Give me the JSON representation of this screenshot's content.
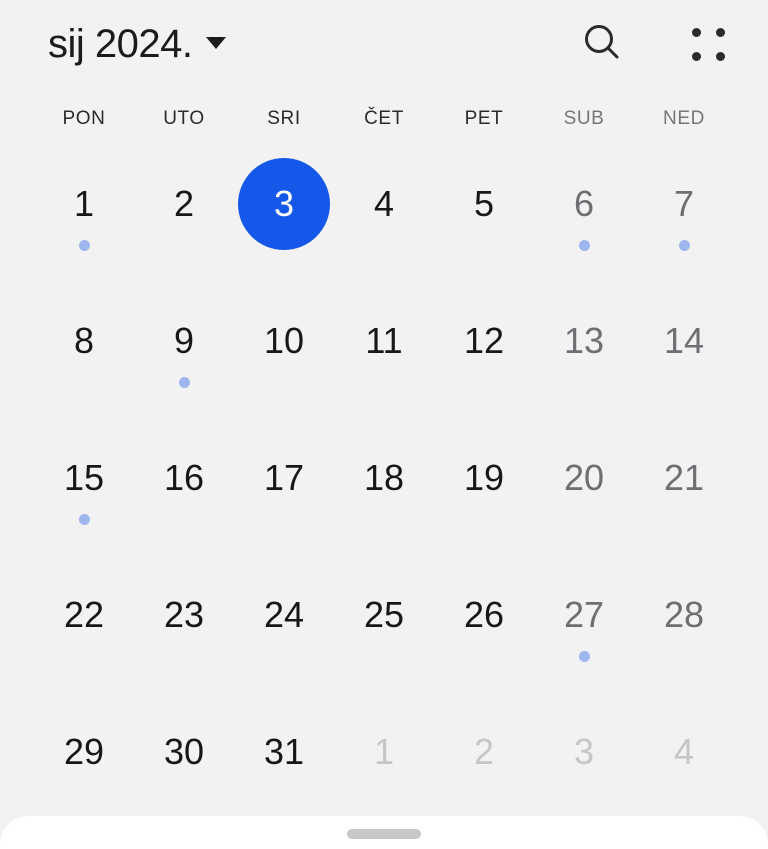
{
  "header": {
    "month_title": "sij 2024.",
    "caret_icon": "chevron-down-icon",
    "search_icon": "search-icon",
    "grid_icon": "four-dot-grid-icon"
  },
  "weekdays": [
    {
      "label": "PON",
      "weekend": false
    },
    {
      "label": "UTO",
      "weekend": false
    },
    {
      "label": "SRI",
      "weekend": false
    },
    {
      "label": "ČET",
      "weekend": false
    },
    {
      "label": "PET",
      "weekend": false
    },
    {
      "label": "SUB",
      "weekend": true
    },
    {
      "label": "NED",
      "weekend": true
    }
  ],
  "colors": {
    "background": "#f2f2f2",
    "selected_day": "#1557e8",
    "event_dot": "#9eb6ee",
    "day_text": "#171717",
    "weekend_text": "#6e6e73",
    "outside_text": "#c6c6c8",
    "sheet_background": "#ffffff",
    "sheet_handle": "#c8c8c8"
  },
  "weeks": [
    [
      {
        "day": "1",
        "weekend": false,
        "outside": false,
        "selected": false,
        "event": true
      },
      {
        "day": "2",
        "weekend": false,
        "outside": false,
        "selected": false,
        "event": false
      },
      {
        "day": "3",
        "weekend": false,
        "outside": false,
        "selected": true,
        "event": false
      },
      {
        "day": "4",
        "weekend": false,
        "outside": false,
        "selected": false,
        "event": false
      },
      {
        "day": "5",
        "weekend": false,
        "outside": false,
        "selected": false,
        "event": false
      },
      {
        "day": "6",
        "weekend": true,
        "outside": false,
        "selected": false,
        "event": true
      },
      {
        "day": "7",
        "weekend": true,
        "outside": false,
        "selected": false,
        "event": true
      }
    ],
    [
      {
        "day": "8",
        "weekend": false,
        "outside": false,
        "selected": false,
        "event": false
      },
      {
        "day": "9",
        "weekend": false,
        "outside": false,
        "selected": false,
        "event": true
      },
      {
        "day": "10",
        "weekend": false,
        "outside": false,
        "selected": false,
        "event": false
      },
      {
        "day": "11",
        "weekend": false,
        "outside": false,
        "selected": false,
        "event": false
      },
      {
        "day": "12",
        "weekend": false,
        "outside": false,
        "selected": false,
        "event": false
      },
      {
        "day": "13",
        "weekend": true,
        "outside": false,
        "selected": false,
        "event": false
      },
      {
        "day": "14",
        "weekend": true,
        "outside": false,
        "selected": false,
        "event": false
      }
    ],
    [
      {
        "day": "15",
        "weekend": false,
        "outside": false,
        "selected": false,
        "event": true
      },
      {
        "day": "16",
        "weekend": false,
        "outside": false,
        "selected": false,
        "event": false
      },
      {
        "day": "17",
        "weekend": false,
        "outside": false,
        "selected": false,
        "event": false
      },
      {
        "day": "18",
        "weekend": false,
        "outside": false,
        "selected": false,
        "event": false
      },
      {
        "day": "19",
        "weekend": false,
        "outside": false,
        "selected": false,
        "event": false
      },
      {
        "day": "20",
        "weekend": true,
        "outside": false,
        "selected": false,
        "event": false
      },
      {
        "day": "21",
        "weekend": true,
        "outside": false,
        "selected": false,
        "event": false
      }
    ],
    [
      {
        "day": "22",
        "weekend": false,
        "outside": false,
        "selected": false,
        "event": false
      },
      {
        "day": "23",
        "weekend": false,
        "outside": false,
        "selected": false,
        "event": false
      },
      {
        "day": "24",
        "weekend": false,
        "outside": false,
        "selected": false,
        "event": false
      },
      {
        "day": "25",
        "weekend": false,
        "outside": false,
        "selected": false,
        "event": false
      },
      {
        "day": "26",
        "weekend": false,
        "outside": false,
        "selected": false,
        "event": false
      },
      {
        "day": "27",
        "weekend": true,
        "outside": false,
        "selected": false,
        "event": true
      },
      {
        "day": "28",
        "weekend": true,
        "outside": false,
        "selected": false,
        "event": false
      }
    ],
    [
      {
        "day": "29",
        "weekend": false,
        "outside": false,
        "selected": false,
        "event": false
      },
      {
        "day": "30",
        "weekend": false,
        "outside": false,
        "selected": false,
        "event": false
      },
      {
        "day": "31",
        "weekend": false,
        "outside": false,
        "selected": false,
        "event": false
      },
      {
        "day": "1",
        "weekend": false,
        "outside": true,
        "selected": false,
        "event": false
      },
      {
        "day": "2",
        "weekend": false,
        "outside": true,
        "selected": false,
        "event": false
      },
      {
        "day": "3",
        "weekend": true,
        "outside": true,
        "selected": false,
        "event": false
      },
      {
        "day": "4",
        "weekend": true,
        "outside": true,
        "selected": false,
        "event": false
      }
    ]
  ],
  "bottom_sheet": {
    "handle_icon": "drag-handle-icon"
  }
}
